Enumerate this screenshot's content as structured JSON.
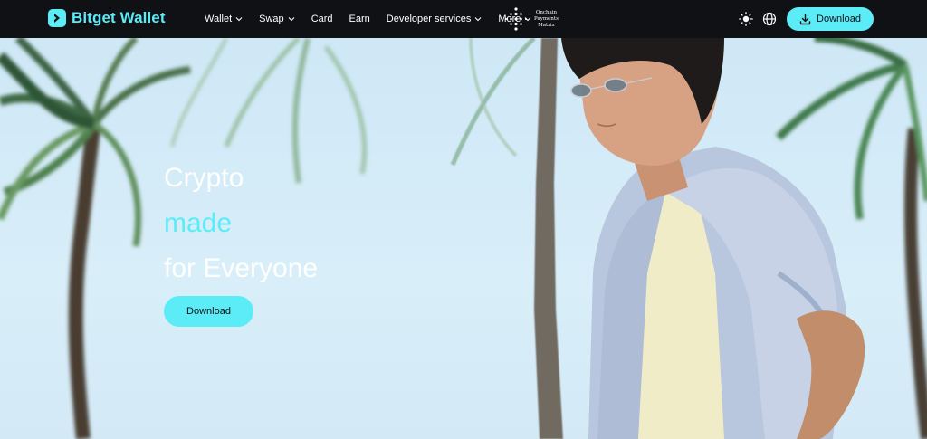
{
  "brand": {
    "name": "Bitget Wallet",
    "accent": "#5cecf7",
    "nav_bg": "#0f1115"
  },
  "nav": {
    "items": [
      {
        "label": "Wallet",
        "dropdown": true
      },
      {
        "label": "Swap",
        "dropdown": true
      },
      {
        "label": "Card",
        "dropdown": false
      },
      {
        "label": "Earn",
        "dropdown": false
      },
      {
        "label": "Developer services",
        "dropdown": true
      },
      {
        "label": "More",
        "dropdown": true
      }
    ],
    "partner": {
      "line1": "Onchain",
      "line2": "Payments",
      "line3": "Matrix",
      "icon": "dot-matrix-icon"
    },
    "theme_icon": "sun-icon",
    "language_icon": "globe-icon",
    "download_label": "Download",
    "download_icon": "download-icon"
  },
  "hero": {
    "line1": "Crypto",
    "line2": "made",
    "line3": "for Everyone",
    "download_label": "Download"
  }
}
